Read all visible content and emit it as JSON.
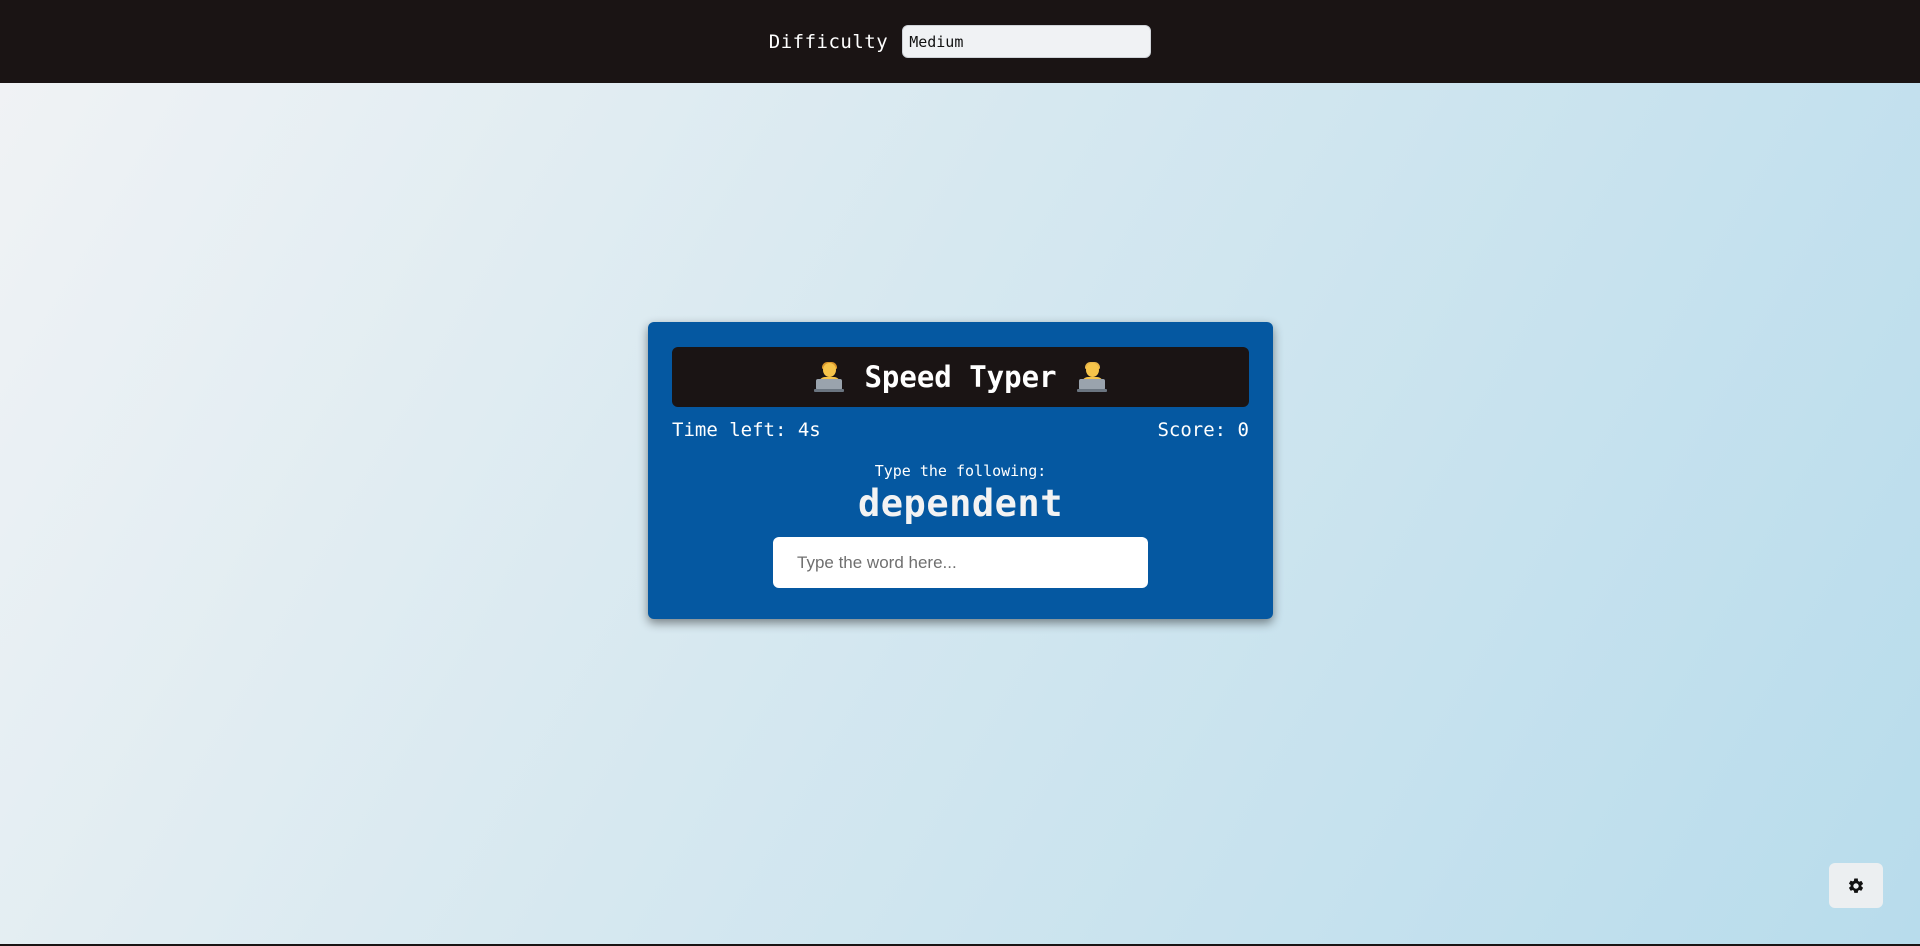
{
  "header": {
    "difficulty_label": "Difficulty",
    "difficulty_value": "Medium"
  },
  "game": {
    "title": "Speed Typer",
    "title_emoji": "person-technologist-icon",
    "time_left": "Time left: 4s",
    "score": "Score: 0",
    "prompt_label": "Type the following:",
    "word": "dependent",
    "input_placeholder": "Type the word here...",
    "input_value": ""
  },
  "settings": {
    "icon": "gear-icon"
  },
  "colors": {
    "topbar": "#1a1414",
    "card": "#0558a1",
    "title_bar": "#1a1414"
  }
}
